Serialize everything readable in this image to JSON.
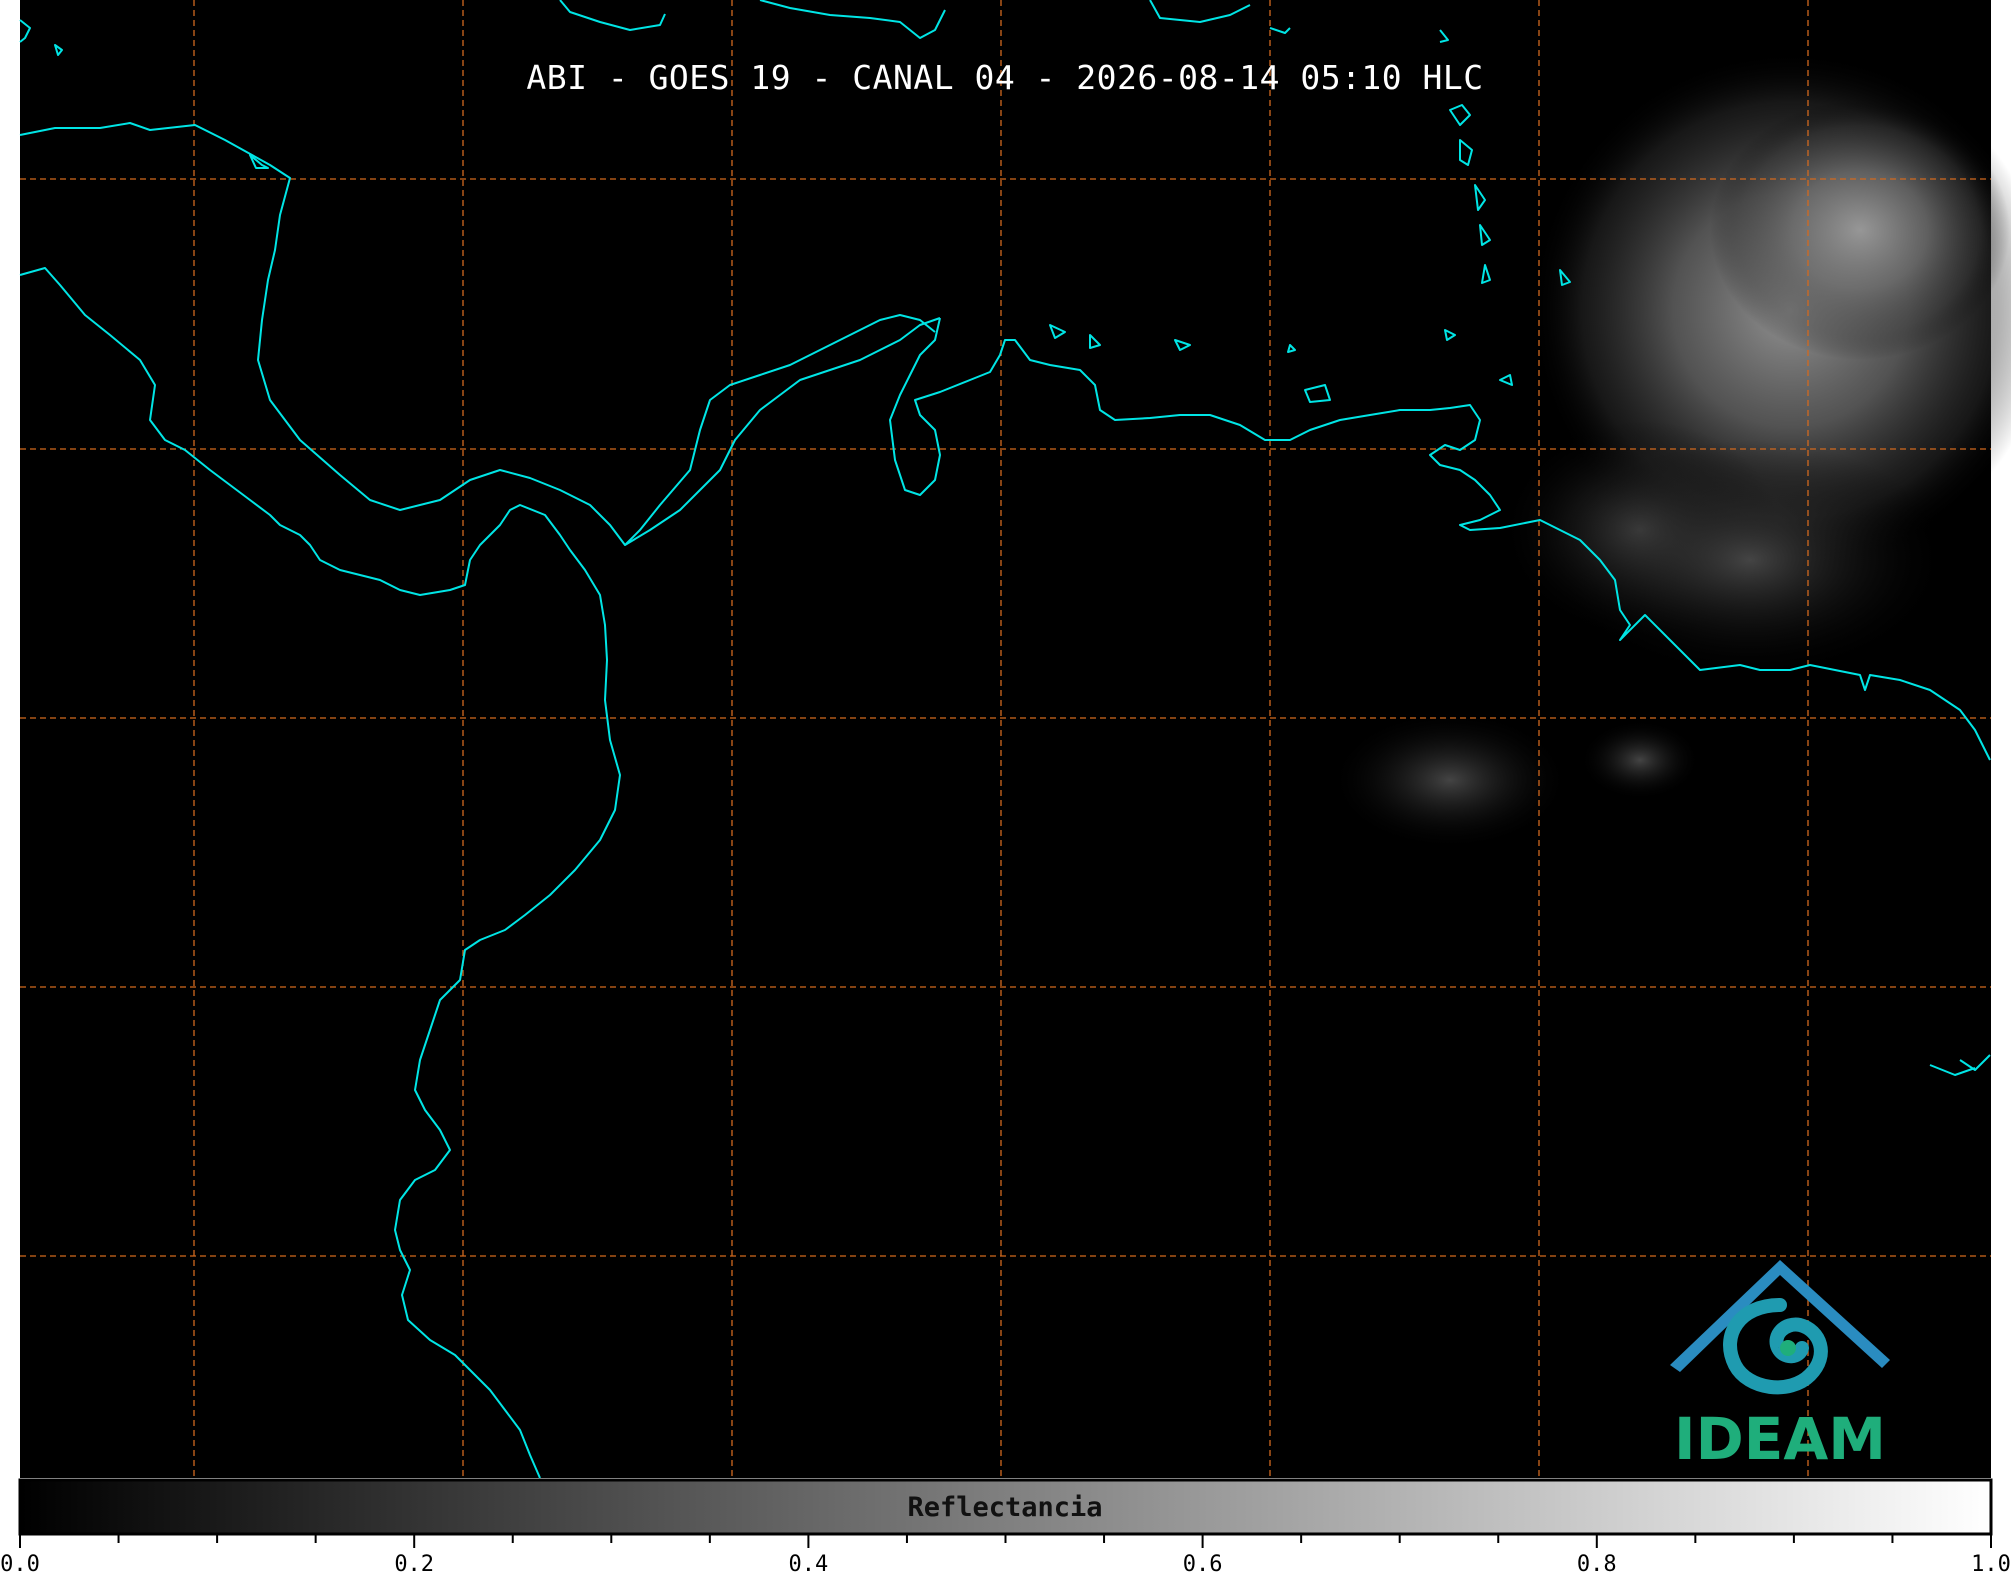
{
  "title": "ABI - GOES 19 - CANAL 04 - 2026-08-14 05:10 HLC",
  "logo": {
    "name": "ideam-logo",
    "text": "IDEAM",
    "colors": [
      "#1e6fb8",
      "#1fae7b"
    ]
  },
  "map": {
    "background": "#000000",
    "coastline_color": "#00e5e5",
    "gridline_color": "#d2691e",
    "gridline_style": "dashed",
    "cloud_region": "upper-right"
  },
  "colorbar": {
    "label": "Reflectancia",
    "range": [
      0.0,
      1.0
    ],
    "cmap": "gray",
    "ticks": [
      {
        "value": 0.0,
        "label": "0.0"
      },
      {
        "value": 0.2,
        "label": "0.2"
      },
      {
        "value": 0.4,
        "label": "0.4"
      },
      {
        "value": 0.6,
        "label": "0.6"
      },
      {
        "value": 0.8,
        "label": "0.8"
      },
      {
        "value": 1.0,
        "label": "1.0"
      }
    ],
    "minor_step": 0.05
  }
}
